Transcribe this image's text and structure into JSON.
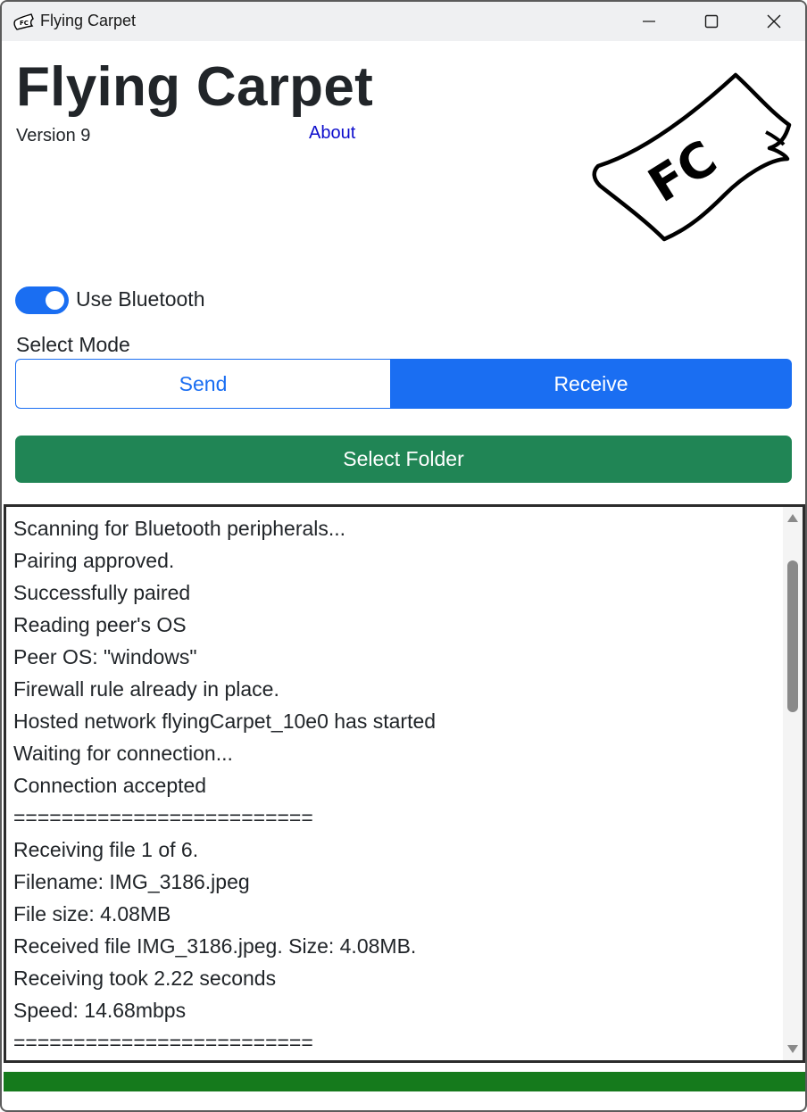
{
  "window": {
    "title": "Flying Carpet",
    "controls": [
      "minimize",
      "maximize",
      "close"
    ]
  },
  "header": {
    "title": "Flying Carpet",
    "version": "Version 9",
    "about_link": "About",
    "logo_text": "FC"
  },
  "bluetooth": {
    "label": "Use Bluetooth",
    "enabled": true
  },
  "mode": {
    "label": "Select Mode",
    "options": [
      "Send",
      "Receive"
    ],
    "selected": "Receive"
  },
  "select_folder_label": "Select Folder",
  "log": {
    "lines": [
      "Scanning for Bluetooth peripherals...",
      "Pairing approved.",
      "Successfully paired",
      "Reading peer's OS",
      "Peer OS: \"windows\"",
      "Firewall rule already in place.",
      "Hosted network flyingCarpet_10e0 has started",
      "Waiting for connection...",
      "Connection accepted",
      "=========================",
      "Receiving file 1 of 6.",
      "Filename: IMG_3186.jpeg",
      "File size: 4.08MB",
      "Received file IMG_3186.jpeg. Size: 4.08MB.",
      "Receiving took 2.22 seconds",
      "Speed: 14.68mbps",
      "========================="
    ]
  },
  "progress": {
    "percent": 100
  },
  "colors": {
    "primary": "#1a6ef2",
    "success": "#208555",
    "progress": "#157a1c",
    "link": "#0d0dcc"
  }
}
